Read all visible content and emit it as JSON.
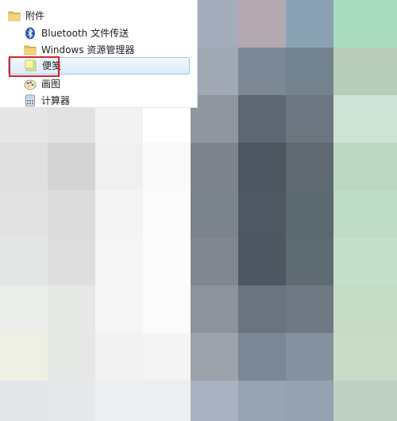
{
  "start_menu": {
    "folder": {
      "label": "附件",
      "icon": "folder-icon"
    },
    "items": [
      {
        "label": "Bluetooth 文件传送",
        "icon": "bluetooth-icon"
      },
      {
        "label": "Windows 资源管理器",
        "icon": "folder-icon"
      },
      {
        "label": "便笺",
        "icon": "sticky-notes-icon",
        "selected": true
      },
      {
        "label": "画图",
        "icon": "paint-icon"
      },
      {
        "label": "计算器",
        "icon": "calculator-icon"
      }
    ]
  },
  "colors": {
    "selection_fill": "#dcebfc",
    "selection_border": "#a4c6ee",
    "annotation_red": "#d42424"
  }
}
